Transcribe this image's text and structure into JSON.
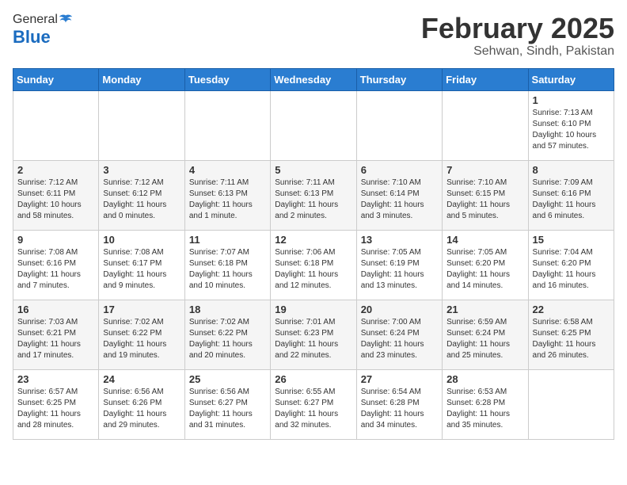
{
  "header": {
    "logo_general": "General",
    "logo_blue": "Blue",
    "month_title": "February 2025",
    "subtitle": "Sehwan, Sindh, Pakistan"
  },
  "weekdays": [
    "Sunday",
    "Monday",
    "Tuesday",
    "Wednesday",
    "Thursday",
    "Friday",
    "Saturday"
  ],
  "rows": [
    [
      {
        "day": "",
        "info": ""
      },
      {
        "day": "",
        "info": ""
      },
      {
        "day": "",
        "info": ""
      },
      {
        "day": "",
        "info": ""
      },
      {
        "day": "",
        "info": ""
      },
      {
        "day": "",
        "info": ""
      },
      {
        "day": "1",
        "info": "Sunrise: 7:13 AM\nSunset: 6:10 PM\nDaylight: 10 hours\nand 57 minutes."
      }
    ],
    [
      {
        "day": "2",
        "info": "Sunrise: 7:12 AM\nSunset: 6:11 PM\nDaylight: 10 hours\nand 58 minutes."
      },
      {
        "day": "3",
        "info": "Sunrise: 7:12 AM\nSunset: 6:12 PM\nDaylight: 11 hours\nand 0 minutes."
      },
      {
        "day": "4",
        "info": "Sunrise: 7:11 AM\nSunset: 6:13 PM\nDaylight: 11 hours\nand 1 minute."
      },
      {
        "day": "5",
        "info": "Sunrise: 7:11 AM\nSunset: 6:13 PM\nDaylight: 11 hours\nand 2 minutes."
      },
      {
        "day": "6",
        "info": "Sunrise: 7:10 AM\nSunset: 6:14 PM\nDaylight: 11 hours\nand 3 minutes."
      },
      {
        "day": "7",
        "info": "Sunrise: 7:10 AM\nSunset: 6:15 PM\nDaylight: 11 hours\nand 5 minutes."
      },
      {
        "day": "8",
        "info": "Sunrise: 7:09 AM\nSunset: 6:16 PM\nDaylight: 11 hours\nand 6 minutes."
      }
    ],
    [
      {
        "day": "9",
        "info": "Sunrise: 7:08 AM\nSunset: 6:16 PM\nDaylight: 11 hours\nand 7 minutes."
      },
      {
        "day": "10",
        "info": "Sunrise: 7:08 AM\nSunset: 6:17 PM\nDaylight: 11 hours\nand 9 minutes."
      },
      {
        "day": "11",
        "info": "Sunrise: 7:07 AM\nSunset: 6:18 PM\nDaylight: 11 hours\nand 10 minutes."
      },
      {
        "day": "12",
        "info": "Sunrise: 7:06 AM\nSunset: 6:18 PM\nDaylight: 11 hours\nand 12 minutes."
      },
      {
        "day": "13",
        "info": "Sunrise: 7:05 AM\nSunset: 6:19 PM\nDaylight: 11 hours\nand 13 minutes."
      },
      {
        "day": "14",
        "info": "Sunrise: 7:05 AM\nSunset: 6:20 PM\nDaylight: 11 hours\nand 14 minutes."
      },
      {
        "day": "15",
        "info": "Sunrise: 7:04 AM\nSunset: 6:20 PM\nDaylight: 11 hours\nand 16 minutes."
      }
    ],
    [
      {
        "day": "16",
        "info": "Sunrise: 7:03 AM\nSunset: 6:21 PM\nDaylight: 11 hours\nand 17 minutes."
      },
      {
        "day": "17",
        "info": "Sunrise: 7:02 AM\nSunset: 6:22 PM\nDaylight: 11 hours\nand 19 minutes."
      },
      {
        "day": "18",
        "info": "Sunrise: 7:02 AM\nSunset: 6:22 PM\nDaylight: 11 hours\nand 20 minutes."
      },
      {
        "day": "19",
        "info": "Sunrise: 7:01 AM\nSunset: 6:23 PM\nDaylight: 11 hours\nand 22 minutes."
      },
      {
        "day": "20",
        "info": "Sunrise: 7:00 AM\nSunset: 6:24 PM\nDaylight: 11 hours\nand 23 minutes."
      },
      {
        "day": "21",
        "info": "Sunrise: 6:59 AM\nSunset: 6:24 PM\nDaylight: 11 hours\nand 25 minutes."
      },
      {
        "day": "22",
        "info": "Sunrise: 6:58 AM\nSunset: 6:25 PM\nDaylight: 11 hours\nand 26 minutes."
      }
    ],
    [
      {
        "day": "23",
        "info": "Sunrise: 6:57 AM\nSunset: 6:25 PM\nDaylight: 11 hours\nand 28 minutes."
      },
      {
        "day": "24",
        "info": "Sunrise: 6:56 AM\nSunset: 6:26 PM\nDaylight: 11 hours\nand 29 minutes."
      },
      {
        "day": "25",
        "info": "Sunrise: 6:56 AM\nSunset: 6:27 PM\nDaylight: 11 hours\nand 31 minutes."
      },
      {
        "day": "26",
        "info": "Sunrise: 6:55 AM\nSunset: 6:27 PM\nDaylight: 11 hours\nand 32 minutes."
      },
      {
        "day": "27",
        "info": "Sunrise: 6:54 AM\nSunset: 6:28 PM\nDaylight: 11 hours\nand 34 minutes."
      },
      {
        "day": "28",
        "info": "Sunrise: 6:53 AM\nSunset: 6:28 PM\nDaylight: 11 hours\nand 35 minutes."
      },
      {
        "day": "",
        "info": ""
      }
    ]
  ]
}
